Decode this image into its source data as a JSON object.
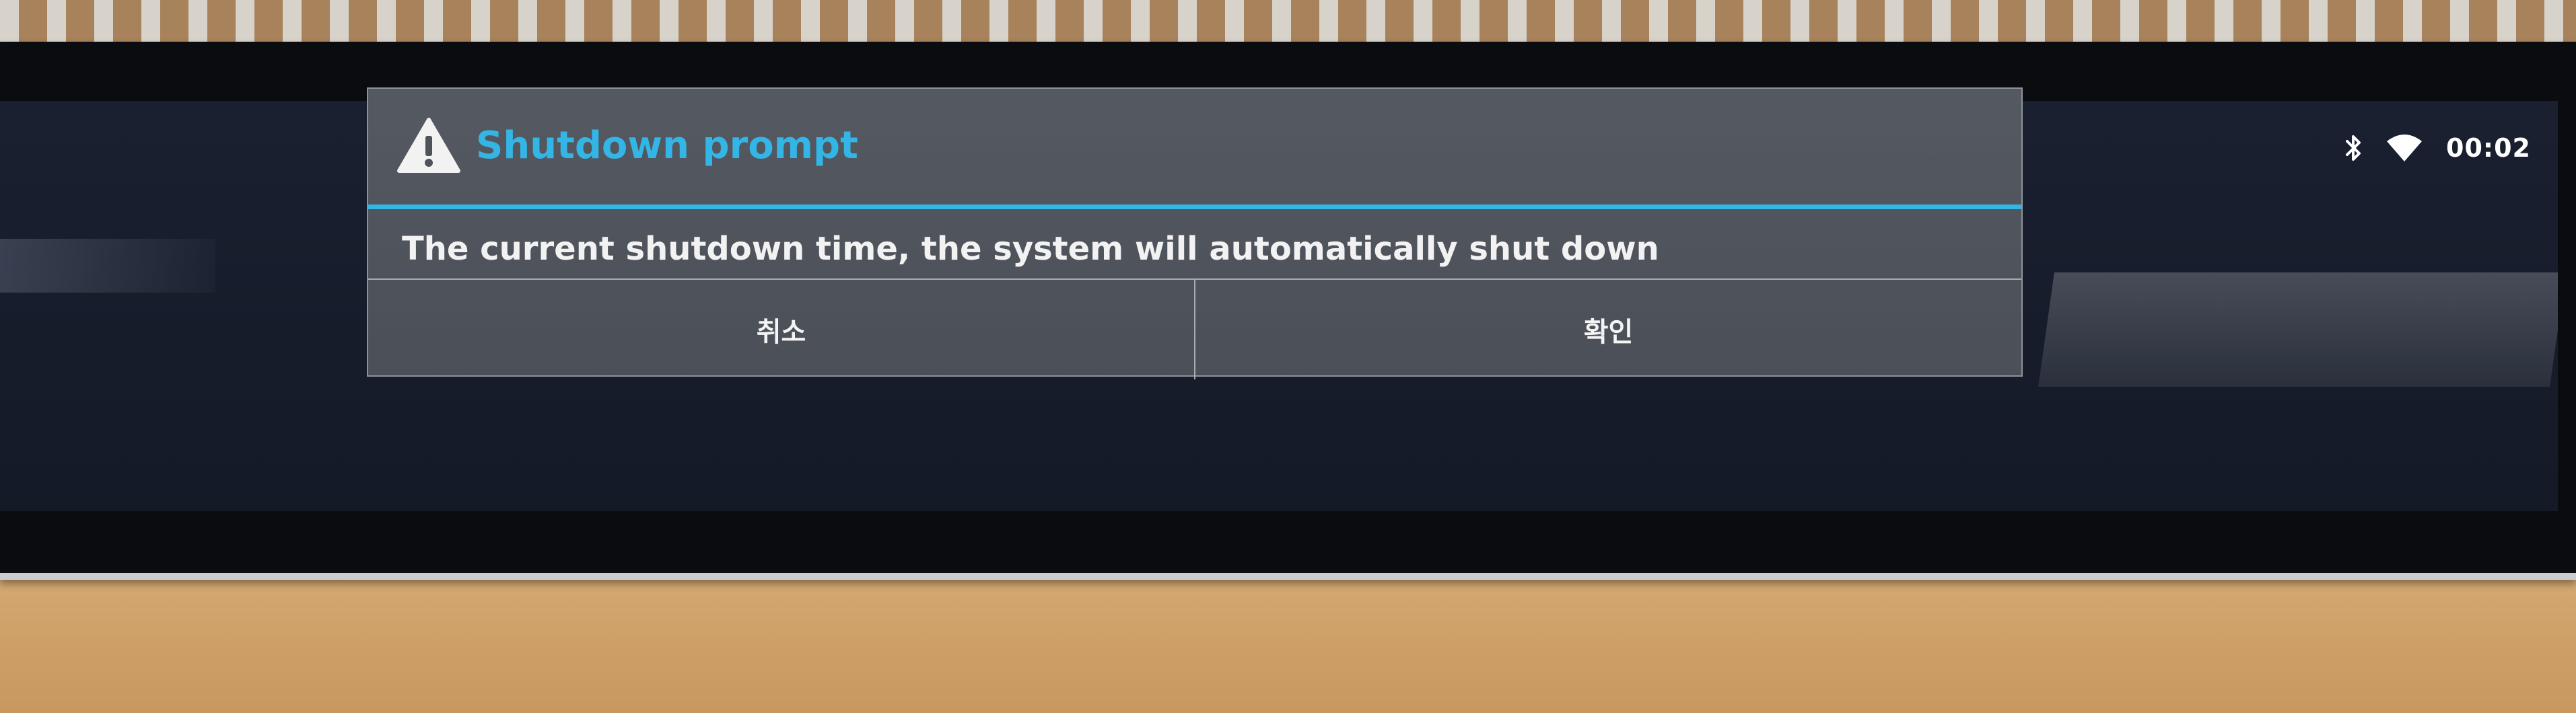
{
  "status_bar": {
    "bluetooth_icon": "bluetooth-icon",
    "wifi_icon": "wifi-icon",
    "time": "00:02"
  },
  "dialog": {
    "icon": "warning-icon",
    "title": "Shutdown prompt",
    "message": "The current shutdown time, the system will automatically shut down",
    "buttons": {
      "cancel": "취소",
      "ok": "확인"
    }
  },
  "colors": {
    "accent": "#33b5e5",
    "dialog_bg": "#585c64",
    "screen_bg": "#1a2030"
  }
}
